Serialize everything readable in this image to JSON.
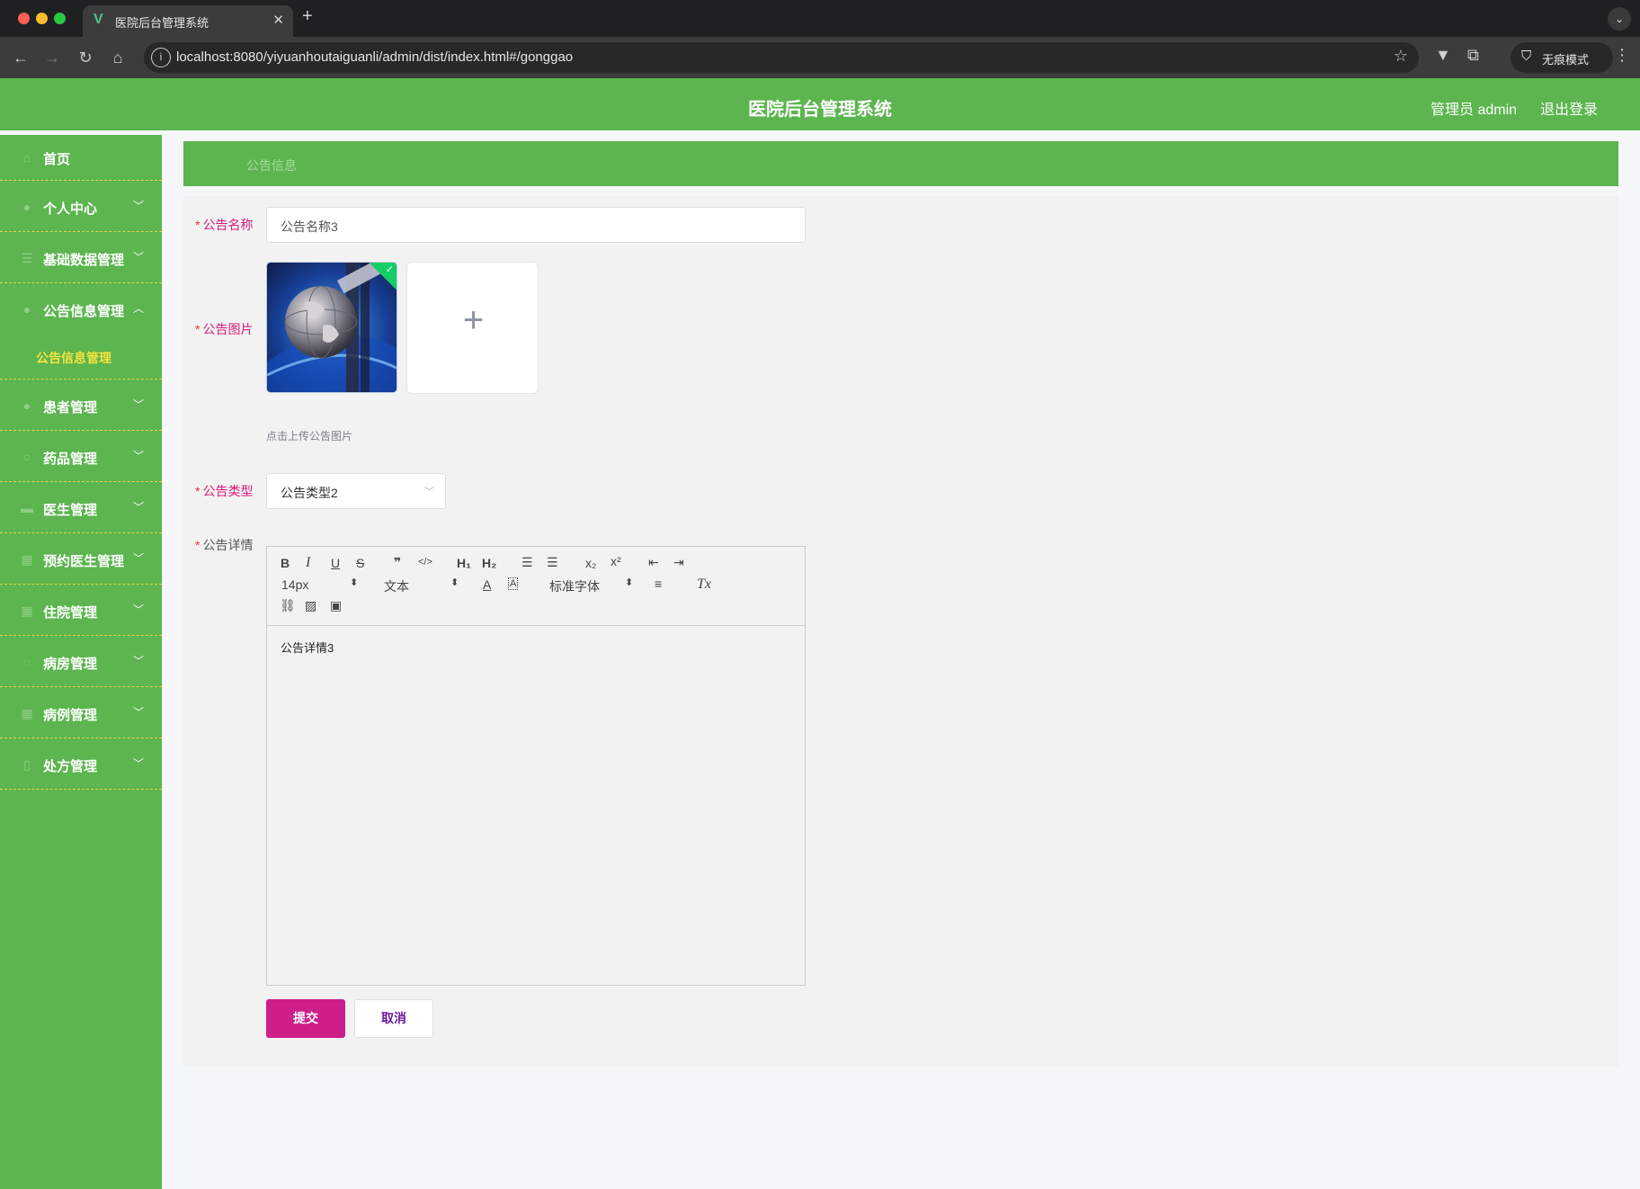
{
  "browser": {
    "tab_title": "医院后台管理系统",
    "tab_favicon": "V",
    "url": "localhost:8080/yiyuanhoutaiguanli/admin/dist/index.html#/gonggao",
    "incognito_label": "无痕模式"
  },
  "header": {
    "title": "医院后台管理系统",
    "user_label": "管理员 admin",
    "logout_label": "退出登录",
    "accent_color": "#5cb54f"
  },
  "sidebar": {
    "items": [
      {
        "label": "首页",
        "icon": "home-icon"
      },
      {
        "label": "个人中心",
        "icon": "user-icon"
      },
      {
        "label": "基础数据管理",
        "icon": "list-icon"
      },
      {
        "label": "公告信息管理",
        "icon": "notice-icon",
        "expanded": true
      },
      {
        "label": "患者管理",
        "icon": "patient-icon"
      },
      {
        "label": "药品管理",
        "icon": "medicine-icon"
      },
      {
        "label": "医生管理",
        "icon": "doctor-icon"
      },
      {
        "label": "预约医生管理",
        "icon": "calendar-icon"
      },
      {
        "label": "住院管理",
        "icon": "bed-icon"
      },
      {
        "label": "病房管理",
        "icon": "room-icon"
      },
      {
        "label": "病例管理",
        "icon": "case-icon"
      },
      {
        "label": "处方管理",
        "icon": "prescription-icon"
      }
    ],
    "active_sub": "公告信息管理"
  },
  "breadcrumb": "公告信息",
  "form": {
    "name_label": "公告名称",
    "name_value": "公告名称3",
    "image_label": "公告图片",
    "upload_tip": "点击上传公告图片",
    "type_label": "公告类型",
    "type_value": "公告类型2",
    "detail_label": "公告详情",
    "detail_value": "公告详情3",
    "submit_label": "提交",
    "cancel_label": "取消"
  },
  "editor_toolbar": {
    "bold": "B",
    "italic": "I",
    "underline": "U",
    "strike": "S",
    "quote": "❞",
    "code": "</>",
    "h1": "H₁",
    "h2": "H₂",
    "ordered_list": "☰",
    "bullet_list": "☰",
    "subscript": "x₂",
    "superscript": "x²",
    "outdent": "⇤",
    "indent": "⇥",
    "size_value": "14px",
    "header_value": "文本",
    "font_value": "标准字体",
    "color": "A",
    "background": "A",
    "align": "≡",
    "clean": "Tx",
    "link": "⛓",
    "image": "▨",
    "video": "▣"
  }
}
